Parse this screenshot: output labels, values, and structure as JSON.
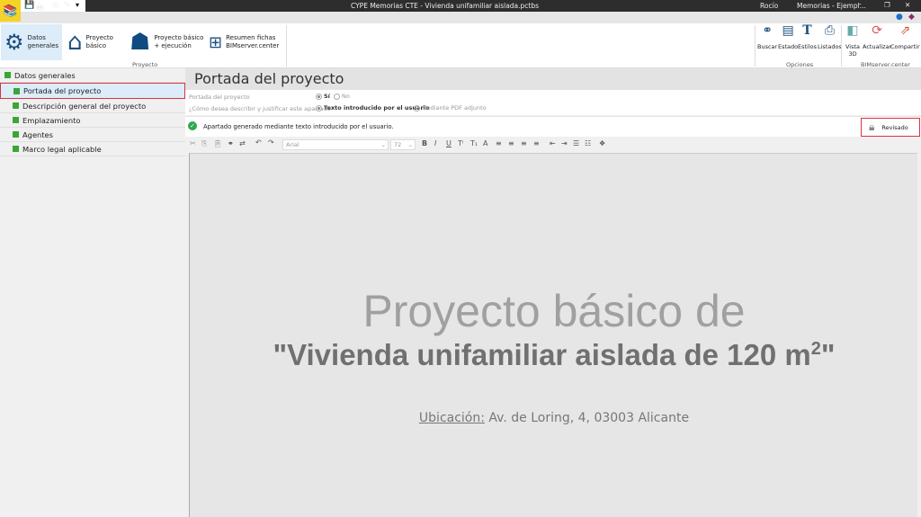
{
  "window": {
    "title": "CYPE Memorias CTE - Vivienda unifamiliar aislada.pctbs",
    "user": "Rocío",
    "project": "Memorias - Ejempl..."
  },
  "ribbon": {
    "proyecto_group": "Proyecto",
    "buttons": [
      {
        "label1": "Datos",
        "label2": "generales"
      },
      {
        "label1": "Proyecto",
        "label2": "básico"
      },
      {
        "label1": "Proyecto básico",
        "label2": "+ ejecución"
      },
      {
        "label1": "Resumen fichas",
        "label2": "BIMserver.center"
      }
    ],
    "opciones_group": "Opciones",
    "opciones": [
      "Buscar",
      "Estado",
      "Estilos",
      "Listados"
    ],
    "bim_group": "BIMserver.center",
    "bim": [
      {
        "label1": "Vista",
        "label2": "3D"
      },
      {
        "label1": "Actualizar",
        "label2": ""
      },
      {
        "label1": "Compartir",
        "label2": ""
      }
    ]
  },
  "sidebar": {
    "root": "Datos generales",
    "items": [
      "Portada del proyecto",
      "Descripción general del proyecto",
      "Emplazamiento",
      "Agentes",
      "Marco legal aplicable"
    ]
  },
  "main": {
    "title": "Portada del proyecto",
    "q1": "Portada del proyecto",
    "q1_yes": "Sí",
    "q1_no": "No",
    "q2": "¿Cómo desea describir y justificar este apartado?",
    "q2_opt1": "Texto introducido por el usuario",
    "q2_opt2": "Mediante PDF adjunto",
    "status": "Apartado generado mediante texto introducido por el usuario.",
    "reviewed": "Revisado",
    "font": "Arial",
    "size": "72"
  },
  "document": {
    "line1": "Proyecto básico de",
    "line2": "\"Vivienda unifamiliar aislada de 120 m",
    "sup": "2",
    "line2_end": "\"",
    "loc_label": "Ubicación:",
    "loc_value": " Av. de Loring, 4, 03003 Alicante"
  }
}
